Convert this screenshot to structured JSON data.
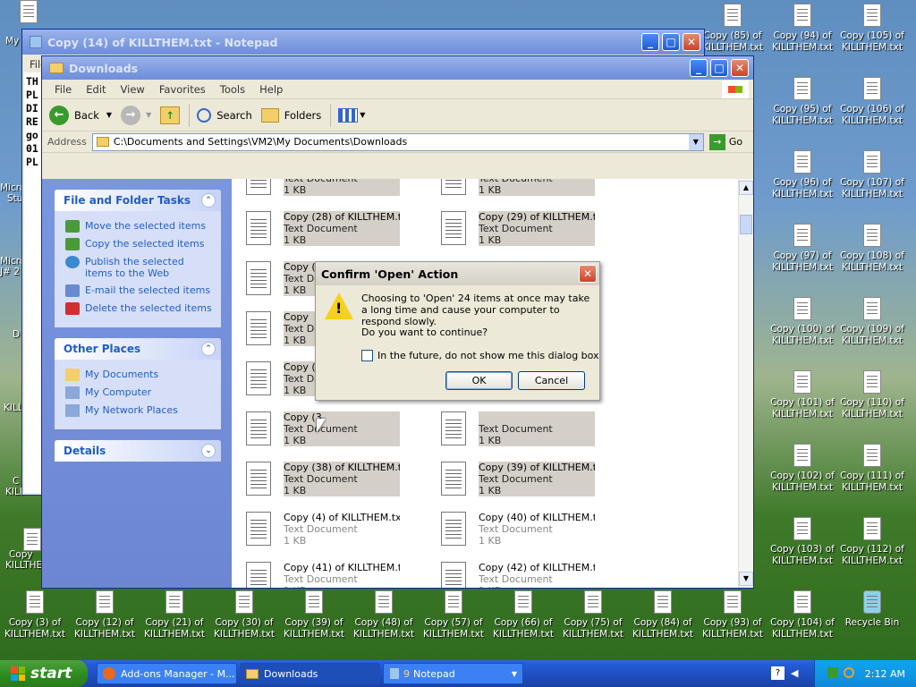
{
  "desktop": {
    "icons": [
      {
        "label": "Copy (85) of KILLTHEM.txt"
      },
      {
        "label": "Copy (94) of KILLTHEM.txt"
      },
      {
        "label": "Copy (105) of KILLTHEM.txt"
      },
      {
        "label": "Copy (95) of KILLTHEM.txt"
      },
      {
        "label": "Copy (106) of KILLTHEM.txt"
      },
      {
        "label": "Copy (96) of KILLTHEM.txt"
      },
      {
        "label": "Copy (107) of KILLTHEM.txt"
      },
      {
        "label": "Copy (97) of KILLTHEM.txt"
      },
      {
        "label": "Copy (108) of KILLTHEM.txt"
      },
      {
        "label": "Copy (100) of KILLTHEM.txt"
      },
      {
        "label": "Copy (109) of KILLTHEM.txt"
      },
      {
        "label": "Copy (101) of KILLTHEM.txt"
      },
      {
        "label": "Copy (110) of KILLTHEM.txt"
      },
      {
        "label": "Copy (102) of KILLTHEM.txt"
      },
      {
        "label": "Copy (111) of KILLTHEM.txt"
      },
      {
        "label": "Copy (103) of KILLTHEM.txt"
      },
      {
        "label": "Copy (112) of KILLTHEM.txt"
      },
      {
        "label": "Copy (104) of KILLTHEM.txt"
      },
      {
        "label": "Copy (3) of KILLTHEM.txt"
      },
      {
        "label": "Copy (12) of KILLTHEM.txt"
      },
      {
        "label": "Copy (21) of KILLTHEM.txt"
      },
      {
        "label": "Copy (30) of KILLTHEM.txt"
      },
      {
        "label": "Copy (39) of KILLTHEM.txt"
      },
      {
        "label": "Copy (48) of KILLTHEM.txt"
      },
      {
        "label": "Copy (57) of KILLTHEM.txt"
      },
      {
        "label": "Copy (66) of KILLTHEM.txt"
      },
      {
        "label": "Copy (75) of KILLTHEM.txt"
      },
      {
        "label": "Copy (84) of KILLTHEM.txt"
      },
      {
        "label": "Copy (93) of KILLTHEM.txt"
      },
      {
        "label": "Recycle Bin"
      }
    ],
    "left_fragments": [
      "My",
      "Micro",
      "Stu",
      "Micro",
      "J# 2",
      "D",
      "KILL",
      "C",
      "KILL",
      "Copy",
      "KILLTHE"
    ]
  },
  "notepad": {
    "title": "Copy (14) of KILLTHEM.txt - Notepad",
    "menu_fragment": "File",
    "text_lines": [
      "TH",
      "PL",
      "DI",
      "RE",
      "go",
      "01",
      "PL"
    ]
  },
  "explorer": {
    "title": "Downloads",
    "menu": [
      "File",
      "Edit",
      "View",
      "Favorites",
      "Tools",
      "Help"
    ],
    "toolbar": {
      "back": "Back",
      "search": "Search",
      "folders": "Folders"
    },
    "address_label": "Address",
    "address_value": "C:\\Documents and Settings\\VM2\\My Documents\\Downloads",
    "go_label": "Go",
    "file_tasks": {
      "title": "File and Folder Tasks",
      "items": [
        "Move the selected items",
        "Copy the selected items",
        "Publish the selected items to the Web",
        "E-mail the selected items",
        "Delete the selected items"
      ]
    },
    "other_places": {
      "title": "Other Places",
      "items": [
        "My Documents",
        "My Computer",
        "My Network Places"
      ]
    },
    "details": {
      "title": "Details"
    },
    "files": [
      {
        "name": "",
        "type": "Text Document",
        "size": "1 KB",
        "selected": true
      },
      {
        "name": "",
        "type": "Text Document",
        "size": "1 KB",
        "selected": true
      },
      {
        "name": "Copy (28) of KILLTHEM.txt",
        "type": "Text Document",
        "size": "1 KB",
        "selected": true
      },
      {
        "name": "Copy (29) of KILLTHEM.txt",
        "type": "Text Document",
        "size": "1 KB",
        "selected": true
      },
      {
        "name": "Copy (30) of KILLTHEM.txt",
        "type": "Text Document",
        "size": "1 KB",
        "selected": true
      },
      {
        "name": "Copy (31) of KILLTHEM.txt",
        "type": "Text Document",
        "size": "1 KB",
        "selected": true
      },
      {
        "name": "Copy",
        "type": "Text Document",
        "size": "1 KB",
        "selected": true
      },
      {
        "name": "",
        "type": "Text Document",
        "size": "1 KB",
        "selected": true
      },
      {
        "name": "Copy (3",
        "type": "Text Document",
        "size": "1 KB",
        "selected": true
      },
      {
        "name": "",
        "type": "Text Document",
        "size": "1 KB",
        "selected": true
      },
      {
        "name": "Copy (3",
        "type": "Text Document",
        "size": "1 KB",
        "selected": true
      },
      {
        "name": "",
        "type": "Text Document",
        "size": "1 KB",
        "selected": true
      },
      {
        "name": "Copy (38) of KILLTHEM.txt",
        "type": "Text Document",
        "size": "1 KB",
        "selected": true
      },
      {
        "name": "Copy (39) of KILLTHEM.txt",
        "type": "Text Document",
        "size": "1 KB",
        "selected": true
      },
      {
        "name": "Copy (4) of KILLTHEM.txt",
        "type": "Text Document",
        "size": "1 KB",
        "selected": false
      },
      {
        "name": "Copy (40) of KILLTHEM.txt",
        "type": "Text Document",
        "size": "1 KB",
        "selected": false
      },
      {
        "name": "Copy (41) of KILLTHEM.txt",
        "type": "Text Document",
        "size": "1 KB",
        "selected": false
      },
      {
        "name": "Copy (42) of KILLTHEM.txt",
        "type": "Text Document",
        "size": "1 KB",
        "selected": false
      }
    ]
  },
  "dialog": {
    "title": "Confirm 'Open' Action",
    "message": "Choosing to 'Open' 24 items at once may take a long time and cause your computer to respond slowly.",
    "question": "Do you want to continue?",
    "checkbox_label": "In the future, do not show me this dialog box",
    "checkbox_checked": false,
    "ok_label": "OK",
    "cancel_label": "Cancel"
  },
  "taskbar": {
    "start_label": "start",
    "items": [
      {
        "label": "Add-ons Manager - M..."
      },
      {
        "label": "Downloads"
      },
      {
        "label": "Notepad",
        "count": "9"
      }
    ],
    "clock": "2:12 AM"
  },
  "colors": {
    "accent": "#0a58e0",
    "link": "#215dc6",
    "start_green": "#2c8a1e"
  }
}
